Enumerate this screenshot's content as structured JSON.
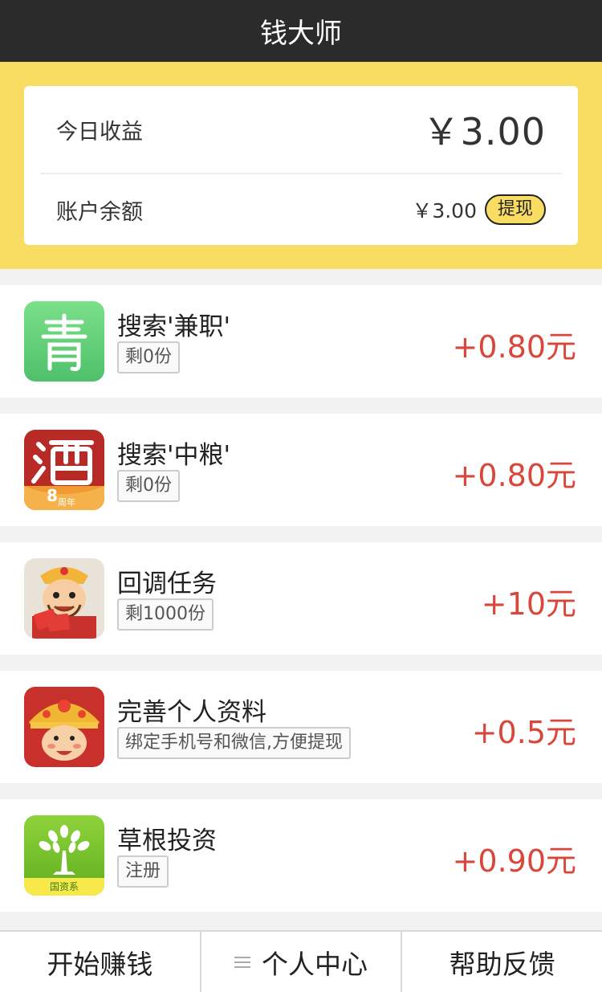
{
  "app": {
    "title": "钱大师"
  },
  "earnings": {
    "today_label": "今日收益",
    "today_amount": "￥3.00",
    "balance_label": "账户余额",
    "balance_amount": "￥3.00",
    "withdraw_label": "提现"
  },
  "tasks": [
    {
      "icon": "qing-app-icon",
      "title": "搜索'兼职'",
      "tag": "剩0份",
      "reward": "+0.80元"
    },
    {
      "icon": "jiu-app-icon",
      "title": "搜索'中粮'",
      "tag": "剩0份",
      "reward": "+0.80元",
      "badge": "8",
      "badge_sub": "周年"
    },
    {
      "icon": "caishen-character-icon",
      "title": "回调任务",
      "tag": "剩1000份",
      "reward": "+10元"
    },
    {
      "icon": "caishen-crown-icon",
      "title": "完善个人资料",
      "tag": "绑定手机号和微信,方便提现",
      "reward": "+0.5元"
    },
    {
      "icon": "tree-app-icon",
      "title": "草根投资",
      "tag": "注册",
      "reward": "+0.90元",
      "badge": "国资系"
    }
  ],
  "tabbar": {
    "tabs": [
      {
        "label": "开始赚钱"
      },
      {
        "label": "个人中心",
        "icon": "menu-icon"
      },
      {
        "label": "帮助反馈"
      }
    ]
  },
  "colors": {
    "accent": "#f9dc62",
    "reward": "#d9463a",
    "titlebar": "#2b2b2b"
  }
}
